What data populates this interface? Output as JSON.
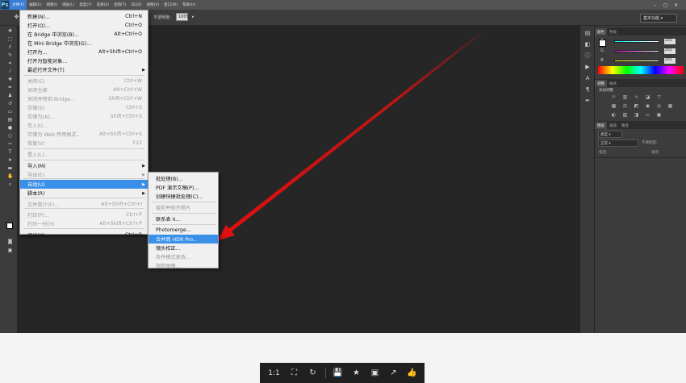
{
  "menubar": {
    "logo": "Ps",
    "items": [
      "文件(F)",
      "编辑(E)",
      "图像(I)",
      "图层(L)",
      "类型(Y)",
      "选择(S)",
      "滤镜(T)",
      "3D(D)",
      "视图(V)",
      "窗口(W)",
      "帮助(H)"
    ],
    "minimize": "–",
    "restore": "▢",
    "close": "✕"
  },
  "options": {
    "opacity_label": "不透明度:",
    "opacity_value": "100%",
    "workspace": "基本功能"
  },
  "file_menu": [
    {
      "label": "新建(N)...",
      "shortcut": "Ctrl+N",
      "state": "enabled"
    },
    {
      "label": "打开(O)...",
      "shortcut": "Ctrl+O",
      "state": "enabled"
    },
    {
      "label": "在 Bridge 中浏览(B)...",
      "shortcut": "Alt+Ctrl+O",
      "state": "enabled"
    },
    {
      "label": "在 Mini Bridge 中浏览(G)...",
      "shortcut": "",
      "state": "enabled"
    },
    {
      "label": "打开为...",
      "shortcut": "Alt+Shift+Ctrl+O",
      "state": "enabled"
    },
    {
      "label": "打开为智能对象...",
      "shortcut": "",
      "state": "enabled"
    },
    {
      "label": "最近打开文件(T)",
      "shortcut": "",
      "state": "enabled",
      "submenu": true
    },
    {
      "label": "关闭(C)",
      "shortcut": "Ctrl+W",
      "state": "disabled"
    },
    {
      "label": "关闭全部",
      "shortcut": "Alt+Ctrl+W",
      "state": "disabled"
    },
    {
      "label": "关闭并转到 Bridge...",
      "shortcut": "Shift+Ctrl+W",
      "state": "disabled"
    },
    {
      "label": "存储(S)",
      "shortcut": "Ctrl+S",
      "state": "disabled"
    },
    {
      "label": "存储为(A)...",
      "shortcut": "Shift+Ctrl+S",
      "state": "disabled"
    },
    {
      "label": "签入(I)...",
      "shortcut": "",
      "state": "disabled"
    },
    {
      "label": "存储为 Web 所用格式...",
      "shortcut": "Alt+Shift+Ctrl+S",
      "state": "disabled"
    },
    {
      "label": "恢复(V)",
      "shortcut": "F12",
      "state": "disabled"
    },
    {
      "label": "置入(L)...",
      "shortcut": "",
      "state": "disabled"
    },
    {
      "label": "导入(M)",
      "shortcut": "",
      "state": "enabled",
      "submenu": true
    },
    {
      "label": "导出(E)",
      "shortcut": "",
      "state": "disabled",
      "submenu": true
    },
    {
      "label": "自动(U)",
      "shortcut": "",
      "state": "highlighted",
      "submenu": true
    },
    {
      "label": "脚本(R)",
      "shortcut": "",
      "state": "enabled",
      "submenu": true
    },
    {
      "label": "文件简介(F)...",
      "shortcut": "Alt+Shift+Ctrl+I",
      "state": "disabled"
    },
    {
      "label": "打印(P)...",
      "shortcut": "Ctrl+P",
      "state": "disabled"
    },
    {
      "label": "打印一份(Y)",
      "shortcut": "Alt+Shift+Ctrl+P",
      "state": "disabled"
    },
    {
      "label": "退出(X)",
      "shortcut": "Ctrl+Q",
      "state": "enabled"
    }
  ],
  "auto_submenu": [
    {
      "label": "批处理(B)...",
      "state": "enabled"
    },
    {
      "label": "PDF 演示文稿(P)...",
      "state": "enabled"
    },
    {
      "label": "创建快捷批处理(C)...",
      "state": "enabled"
    },
    {
      "label": "裁剪并修齐照片",
      "state": "disabled"
    },
    {
      "label": "联系表 II...",
      "state": "enabled"
    },
    {
      "label": "Photomerge...",
      "state": "enabled"
    },
    {
      "label": "合并到 HDR Pro...",
      "state": "highlighted"
    },
    {
      "label": "镜头校正...",
      "state": "enabled"
    },
    {
      "label": "条件模式更改...",
      "state": "disabled"
    },
    {
      "label": "限制图像...",
      "state": "disabled"
    }
  ],
  "panels": {
    "color_tabs": [
      "颜色",
      "色板"
    ],
    "rgb": [
      {
        "label": "R",
        "value": "255"
      },
      {
        "label": "G",
        "value": "255"
      },
      {
        "label": "B",
        "value": "255"
      }
    ],
    "adjust_tabs": [
      "调整",
      "样式"
    ],
    "adjust_title": "添加调整",
    "layer_tabs": [
      "图层",
      "通道",
      "路径"
    ],
    "layer_kind": "类型",
    "blend_mode": "正常",
    "opacity_label": "不透明度:",
    "lock_label": "锁定:",
    "fill_label": "填充:"
  },
  "viewer": {
    "actual_size": "1:1"
  },
  "colors": {
    "accent": "#3a8fe8",
    "arrow": "#e01010"
  }
}
